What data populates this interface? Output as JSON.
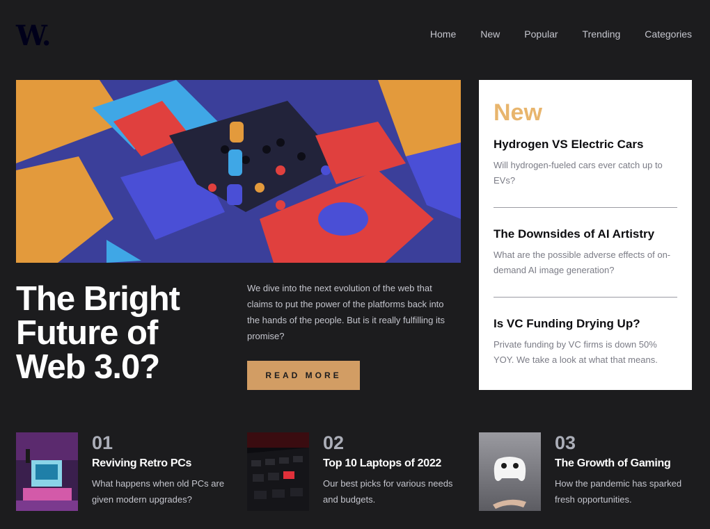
{
  "logo": "W.",
  "nav": [
    "Home",
    "New",
    "Popular",
    "Trending",
    "Categories"
  ],
  "hero": {
    "title": "The Bright Future of Web 3.0?",
    "description": "We dive into the next evolution of the web that claims to put the power of the platforms back into the hands of the people. But is it really fulfilling its promise?",
    "button": "READ MORE"
  },
  "new_panel": {
    "heading": "New",
    "items": [
      {
        "title": "Hydrogen VS Electric Cars",
        "desc": "Will hydrogen-fueled cars ever catch up to EVs?"
      },
      {
        "title": "The Downsides of AI Artistry",
        "desc": "What are the possible adverse effects of on-demand AI image generation?"
      },
      {
        "title": "Is VC Funding Drying Up?",
        "desc": "Private funding by VC firms is down 50% YOY. We take a look at what that means."
      }
    ]
  },
  "features": [
    {
      "num": "01",
      "title": "Reviving Retro PCs",
      "desc": "What happens when old PCs are given modern upgrades?"
    },
    {
      "num": "02",
      "title": "Top 10 Laptops of 2022",
      "desc": "Our best picks for various needs and budgets."
    },
    {
      "num": "03",
      "title": "The Growth of Gaming",
      "desc": "How the pandemic has sparked fresh opportunities."
    }
  ],
  "colors": {
    "background": "#1c1c1e",
    "accent": "#e8b56d",
    "button": "#d29d64"
  }
}
